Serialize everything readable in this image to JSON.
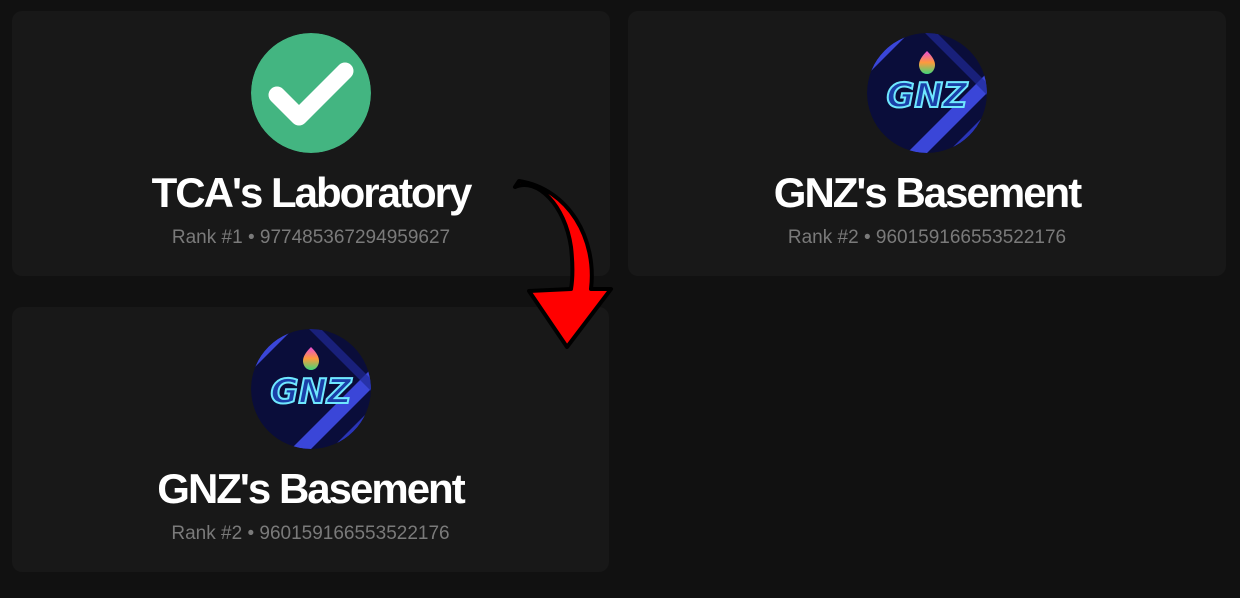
{
  "servers": [
    {
      "name": "TCA's Laboratory",
      "rank": "Rank #1",
      "separator": "•",
      "id": "977485367294959627",
      "icon": "checkmark-icon"
    },
    {
      "name": "GNZ's Basement",
      "rank": "Rank #2",
      "separator": "•",
      "id": "960159166553522176",
      "icon": "gnz-logo-icon",
      "logo_text": "GNZ"
    },
    {
      "name": "GNZ's Basement",
      "rank": "Rank #2",
      "separator": "•",
      "id": "960159166553522176",
      "icon": "gnz-logo-icon",
      "logo_text": "GNZ"
    }
  ],
  "colors": {
    "page_background": "#111111",
    "card_background": "#181818",
    "checkmark_green": "#43b581",
    "arrow_red": "#ff0000",
    "meta_text": "#7a7a7a"
  },
  "annotation": {
    "arrow": "red-curved-down-arrow-icon"
  }
}
